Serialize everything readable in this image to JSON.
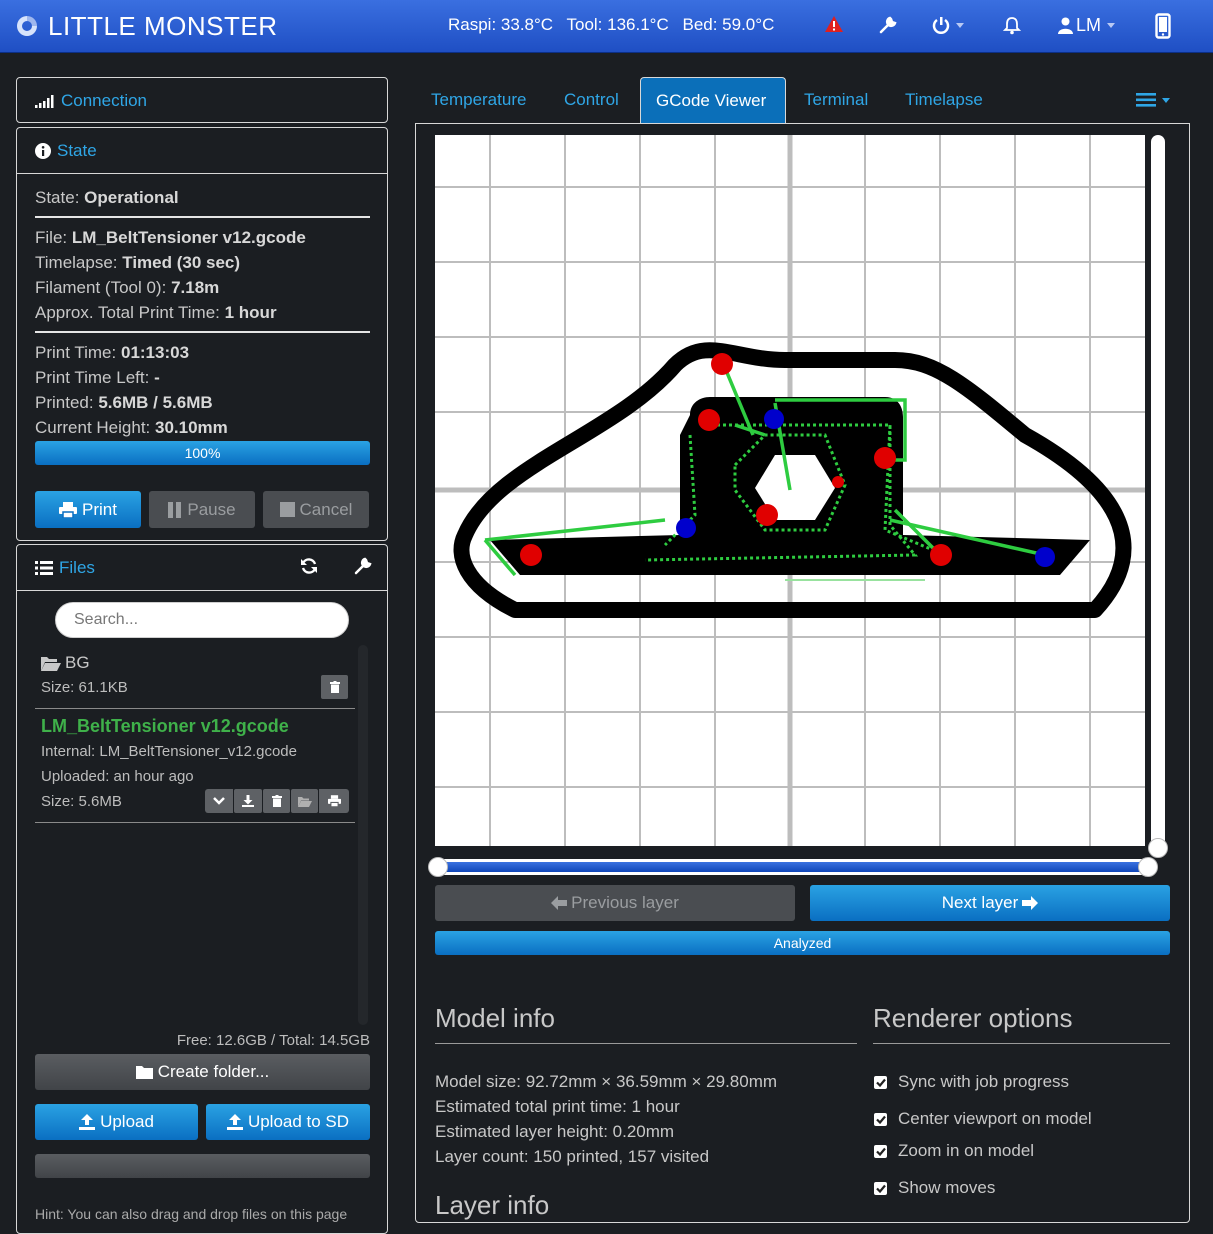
{
  "app": {
    "title": "LITTLE MONSTER"
  },
  "navbar": {
    "raspi": "Raspi: 33.8°C",
    "tool": "Tool: 136.1°C",
    "bed": "Bed: 59.0°C",
    "user": "LM",
    "icons": [
      "warning-icon",
      "wrench-icon",
      "power-icon",
      "bell-icon",
      "user-icon",
      "mobile-icon"
    ],
    "warning_color": "#e02020"
  },
  "connection": {
    "title": "Connection"
  },
  "state": {
    "title": "State",
    "state_label": "State:",
    "state_value": "Operational",
    "file_label": "File:",
    "file_value": "LM_BeltTensioner v12.gcode",
    "timelapse_label": "Timelapse:",
    "timelapse_value": "Timed (30 sec)",
    "filament_label": "Filament (Tool 0):",
    "filament_value": "7.18m",
    "approx_label": "Approx. Total Print Time:",
    "approx_value": "1 hour",
    "print_time_label": "Print Time:",
    "print_time_value": "01:13:03",
    "time_left_label": "Print Time Left:",
    "time_left_value": "-",
    "printed_label": "Printed:",
    "printed_value": "5.6MB / 5.6MB",
    "height_label": "Current Height:",
    "height_value": "30.10mm",
    "progress_text": "100%",
    "progress_percent": 100,
    "print_button": "Print",
    "pause_button": "Pause",
    "cancel_button": "Cancel"
  },
  "files": {
    "title": "Files",
    "search_placeholder": "Search...",
    "items": [
      {
        "name": "BG",
        "size": "Size: 61.1KB"
      },
      {
        "name": "LM_BeltTensioner v12.gcode",
        "internal": "Internal: LM_BeltTensioner_v12.gcode",
        "uploaded": "Uploaded: an hour ago",
        "size": "Size: 5.6MB"
      }
    ],
    "free_total": "Free: 12.6GB / Total: 14.5GB",
    "create_folder": "Create folder...",
    "upload": "Upload",
    "upload_sd": "Upload to SD",
    "hint": "Hint: You can also drag and drop files on this page"
  },
  "tabs": {
    "items": [
      "Temperature",
      "Control",
      "GCode Viewer",
      "Terminal",
      "Timelapse"
    ],
    "active": "GCode Viewer"
  },
  "viewer": {
    "prev_layer": "Previous layer",
    "next_layer": "Next layer",
    "analyzed": "Analyzed",
    "layer_slider_fraction": 1.0
  },
  "model_info": {
    "title": "Model info",
    "size": "Model size: 92.72mm × 36.59mm × 29.80mm",
    "est_time": "Estimated total print time: 1 hour",
    "layer_height": "Estimated layer height: 0.20mm",
    "layer_count": "Layer count: 150 printed, 157 visited"
  },
  "renderer": {
    "title": "Renderer options",
    "options": [
      {
        "label": "Sync with job progress",
        "checked": true
      },
      {
        "label": "Center viewport on model",
        "checked": true
      },
      {
        "label": "Zoom in on model",
        "checked": true
      },
      {
        "label": "Show moves",
        "checked": true
      }
    ]
  },
  "layer_info": {
    "title": "Layer info"
  }
}
